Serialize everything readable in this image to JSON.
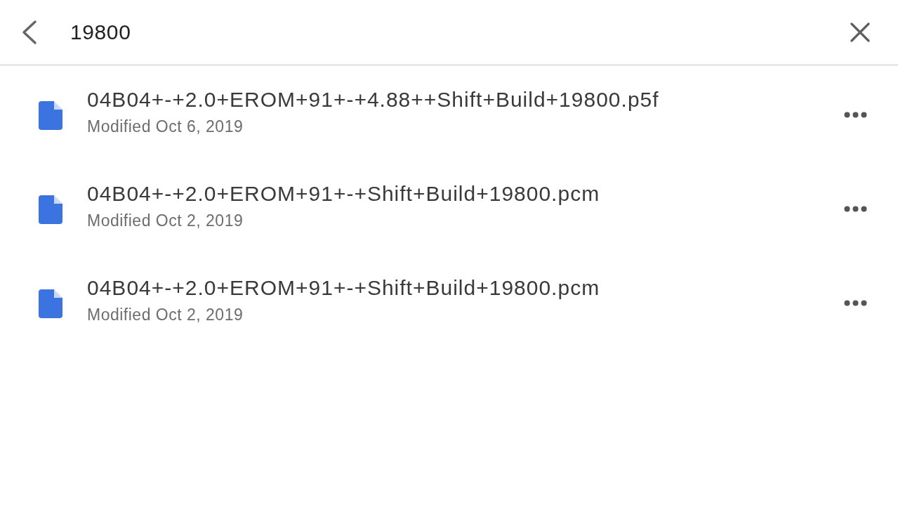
{
  "search_bar": {
    "query": "19800"
  },
  "results": [
    {
      "name": "04B04+-+2.0+EROM+91+-+4.88++Shift+Build+19800.p5f",
      "modified": "Modified Oct 6, 2019"
    },
    {
      "name": "04B04+-+2.0+EROM+91+-+Shift+Build+19800.pcm",
      "modified": "Modified Oct 2, 2019"
    },
    {
      "name": "04B04+-+2.0+EROM+91+-+Shift+Build+19800.pcm",
      "modified": "Modified Oct 2, 2019"
    }
  ]
}
